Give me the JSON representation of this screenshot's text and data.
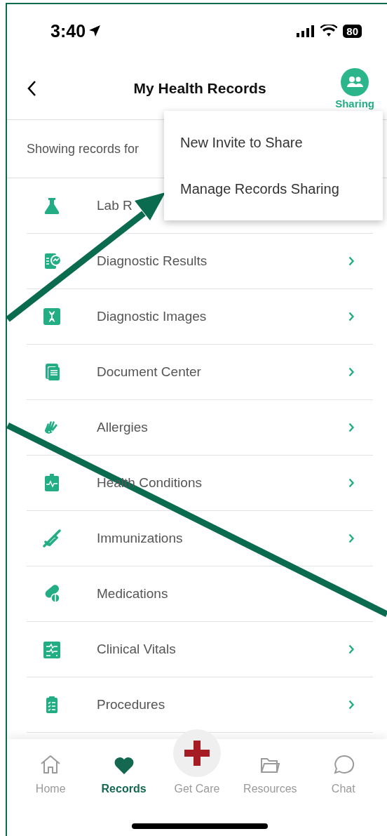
{
  "status_bar": {
    "time": "3:40",
    "battery": "80"
  },
  "header": {
    "title": "My Health Records",
    "sharing_label": "Sharing"
  },
  "filter_text": "Showing records for",
  "records": [
    {
      "label": "Lab R",
      "chevron": false
    },
    {
      "label": "Diagnostic Results",
      "chevron": true
    },
    {
      "label": "Diagnostic Images",
      "chevron": true
    },
    {
      "label": "Document Center",
      "chevron": true
    },
    {
      "label": "Allergies",
      "chevron": true
    },
    {
      "label": "Health Conditions",
      "chevron": true
    },
    {
      "label": "Immunizations",
      "chevron": true
    },
    {
      "label": "Medications",
      "chevron": false
    },
    {
      "label": "Clinical Vitals",
      "chevron": true
    },
    {
      "label": "Procedures",
      "chevron": true
    }
  ],
  "sharing_menu": {
    "items": [
      "New Invite to Share",
      "Manage Records Sharing"
    ]
  },
  "tab_bar": [
    {
      "label": "Home",
      "kind": "tab",
      "selected": false
    },
    {
      "label": "Records",
      "kind": "tab",
      "selected": true
    },
    {
      "label": "Get Care",
      "kind": "featured",
      "selected": false
    },
    {
      "label": "Resources",
      "kind": "tab",
      "selected": false
    },
    {
      "label": "Chat",
      "kind": "tab",
      "selected": false
    }
  ]
}
